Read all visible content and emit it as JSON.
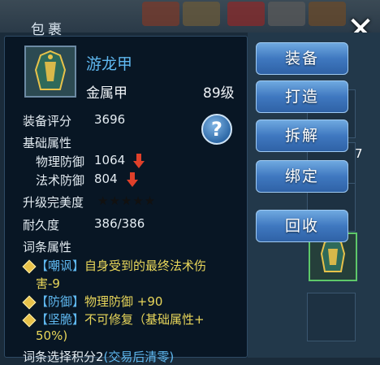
{
  "window": {
    "title": "包裹",
    "close_icon": "close-icon"
  },
  "item": {
    "name": "游龙甲",
    "type": "金属甲",
    "level": "89级",
    "score_label": "装备评分",
    "score_value": "3696"
  },
  "base_attributes": {
    "header": "基础属性",
    "physical_label": "物理防御",
    "physical_value": "1064",
    "magic_label": "法术防御",
    "magic_value": "804",
    "arrow_color": "#e0402a"
  },
  "upgrade": {
    "label": "升级完美度",
    "stars": "★★★★★"
  },
  "durability": {
    "label": "耐久度",
    "value": "386/386"
  },
  "affix": {
    "header": "词条属性",
    "items": [
      {
        "tag": "【嘲讽】",
        "line1": "自身受到的最终法术伤",
        "line2": "害-9"
      },
      {
        "tag": "【防御】",
        "line1": "物理防御 +90"
      },
      {
        "tag": "【坚脆】",
        "line1": "不可修复（基础属性+",
        "line2": "50%)"
      }
    ],
    "footer_prefix": "词条选择积分2",
    "footer_suffix": "(交易后清零)"
  },
  "buttons": {
    "equip": "装备",
    "forge": "打造",
    "disassemble": "拆解",
    "bind": "绑定",
    "recycle": "回收"
  },
  "help": "?",
  "bag": {
    "side_count": "7"
  }
}
